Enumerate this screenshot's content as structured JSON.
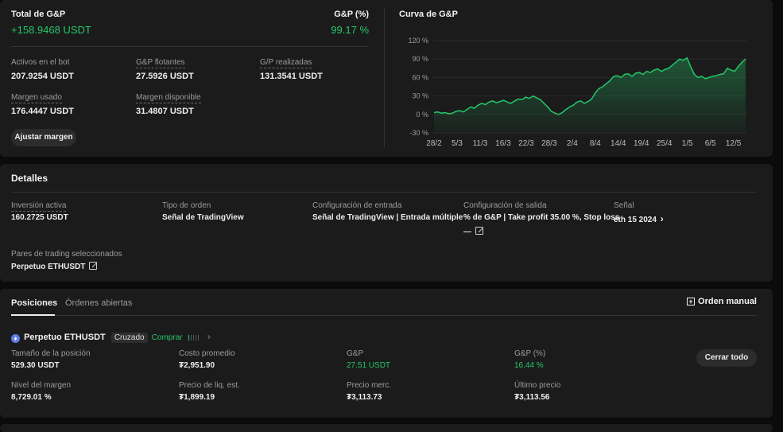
{
  "summary": {
    "total_label": "Total de G&P",
    "total_value": "+158.9468 USDT",
    "pnl_pct_label": "G&P (%)",
    "pnl_pct_value": "99.17 %",
    "assets_label": "Activos en el bot",
    "assets_value": "207.9254 USDT",
    "floating_label": "G&P flotantes",
    "floating_value": "27.5926 USDT",
    "realized_label": "G/P realizadas",
    "realized_value": "131.3541 USDT",
    "margin_used_label": "Margen usado",
    "margin_used_value": "176.4447 USDT",
    "margin_avail_label": "Margen disponible",
    "margin_avail_value": "31.4807 USDT",
    "adjust_margin_button": "Ajustar margen"
  },
  "curve": {
    "title": "Curva de G&P",
    "accent": "#24c76a"
  },
  "chart_data": {
    "type": "area",
    "title": "Curva de G&P",
    "x_ticks": [
      "28/2",
      "5/3",
      "11/3",
      "16/3",
      "22/3",
      "28/3",
      "2/4",
      "8/4",
      "14/4",
      "19/4",
      "25/4",
      "1/5",
      "6/5",
      "12/5"
    ],
    "y_ticks": [
      "120 %",
      "90 %",
      "60 %",
      "30 %",
      "0 %",
      "-30 %"
    ],
    "ylim": [
      -30,
      120
    ],
    "ylabel": "",
    "xlabel": "",
    "series": [
      {
        "values": [
          3,
          4,
          2,
          3,
          1,
          2,
          5,
          6,
          4,
          8,
          12,
          10,
          15,
          18,
          16,
          20,
          22,
          19,
          21,
          23,
          20,
          18,
          22,
          25,
          24,
          28,
          26,
          30,
          27,
          24,
          18,
          12,
          5,
          2,
          0,
          3,
          8,
          12,
          15,
          20,
          22,
          18,
          21,
          25,
          35,
          42,
          45,
          50,
          55,
          62,
          63,
          60,
          65,
          66,
          62,
          67,
          68,
          65,
          70,
          68,
          72,
          74,
          70,
          73,
          75,
          80,
          85,
          90,
          88,
          92,
          78,
          65,
          60,
          62,
          58,
          60,
          62,
          63,
          65,
          66,
          75,
          72,
          70,
          78,
          85,
          90
        ]
      }
    ]
  },
  "details": {
    "title": "Detalles",
    "active_investment_label": "Inversión activa",
    "active_investment_value": "160.2725 USDT",
    "order_type_label": "Tipo de orden",
    "order_type_value": "Señal de TradingView",
    "entry_config_label": "Configuración de entrada",
    "entry_config_value": "Señal de TradingView | Entrada múltiple",
    "exit_config_label": "Configuración de salida",
    "exit_config_value": "% de G&P | Take profit 35.00 %, Stop loss",
    "exit_config_value2": "—",
    "signal_label": "Señal",
    "signal_value": "eth 15 2024",
    "pairs_label": "Pares de trading seleccionados",
    "pairs_value": "Perpetuo ETHUSDT"
  },
  "positions": {
    "tab_positions": "Posiciones",
    "tab_open_orders": "Órdenes abiertas",
    "manual_order": "Orden manual",
    "pair_name": "Perpetuo ETHUSDT",
    "margin_mode": "Cruzado",
    "side": "Comprar",
    "size_label": "Tamaño de la posición",
    "size_value": "529.30 USDT",
    "avg_cost_label": "Costo promedio",
    "avg_cost_value": "₮2,951.90",
    "pnl_label": "G&P",
    "pnl_value": "27.51 USDT",
    "pnl_pct_label": "G&P (%)",
    "pnl_pct_value": "16.44 %",
    "close_all_button": "Cerrar todo",
    "margin_level_label": "Nivel del margen",
    "margin_level_value": "8,729.01 %",
    "liq_price_label": "Precio de liq. est.",
    "liq_price_value": "₮1,899.19",
    "mark_price_label": "Precio merc.",
    "mark_price_value": "₮3,113.73",
    "last_price_label": "Último precio",
    "last_price_value": "₮3,113.56"
  }
}
